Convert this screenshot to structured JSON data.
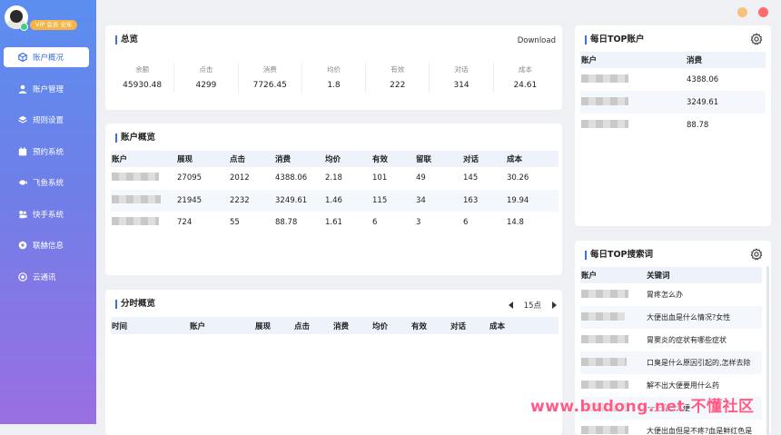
{
  "user": {
    "vip_label": "VIP 会员 全年"
  },
  "window": {
    "dot_colors": [
      "#f7c27b",
      "#ff6b6b"
    ]
  },
  "sidebar": {
    "items": [
      {
        "label": "账户概况",
        "icon": "cube-icon",
        "active": true
      },
      {
        "label": "账户管理",
        "icon": "user-icon"
      },
      {
        "label": "规则设置",
        "icon": "layers-icon"
      },
      {
        "label": "预约系统",
        "icon": "calendar-icon"
      },
      {
        "label": "飞鱼系统",
        "icon": "fish-icon"
      },
      {
        "label": "快手系统",
        "icon": "kuaishou-icon"
      },
      {
        "label": "联赫信息",
        "icon": "link-icon"
      },
      {
        "label": "云通讯",
        "icon": "cloud-icon"
      }
    ]
  },
  "summary": {
    "title": "总览",
    "download_label": "Download",
    "stats": [
      {
        "label": "余额",
        "value": "45930.48"
      },
      {
        "label": "点击",
        "value": "4299"
      },
      {
        "label": "消费",
        "value": "7726.45"
      },
      {
        "label": "均价",
        "value": "1.8"
      },
      {
        "label": "有效",
        "value": "222"
      },
      {
        "label": "对话",
        "value": "314"
      },
      {
        "label": "成本",
        "value": "24.61"
      }
    ]
  },
  "account_overview": {
    "title": "账户概览",
    "headers": [
      "账户",
      "展现",
      "点击",
      "消费",
      "均价",
      "有效",
      "留联",
      "对话",
      "成本"
    ],
    "rows": [
      [
        "27095",
        "2012",
        "4388.06",
        "2.18",
        "101",
        "49",
        "145",
        "30.26"
      ],
      [
        "21945",
        "2232",
        "3249.61",
        "1.46",
        "115",
        "34",
        "163",
        "19.94"
      ],
      [
        "724",
        "55",
        "88.78",
        "1.61",
        "6",
        "3",
        "6",
        "14.8"
      ]
    ]
  },
  "hourly": {
    "title": "分时概览",
    "page_label": "15点",
    "headers": [
      "时间",
      "账户",
      "展现",
      "点击",
      "消费",
      "均价",
      "有效",
      "对话",
      "成本"
    ]
  },
  "top_accounts": {
    "title": "每日TOP账户",
    "headers": [
      "账户",
      "消费"
    ],
    "values": [
      "4388.06",
      "3249.61",
      "88.78"
    ]
  },
  "top_keywords": {
    "title": "每日TOP搜索词",
    "headers": [
      "账户",
      "关键词"
    ],
    "keywords": [
      "胃疼怎么办",
      "大便出血是什么情况?女性",
      "胃窦炎的症状有哪些症状",
      "口臭是什么原因引起的,怎样去除",
      "解不出大便要用什么药",
      "一天几次大便",
      "大便出血但是不疼?血是鲜红色是"
    ]
  },
  "watermark": "www.budong.net 不懂社区"
}
